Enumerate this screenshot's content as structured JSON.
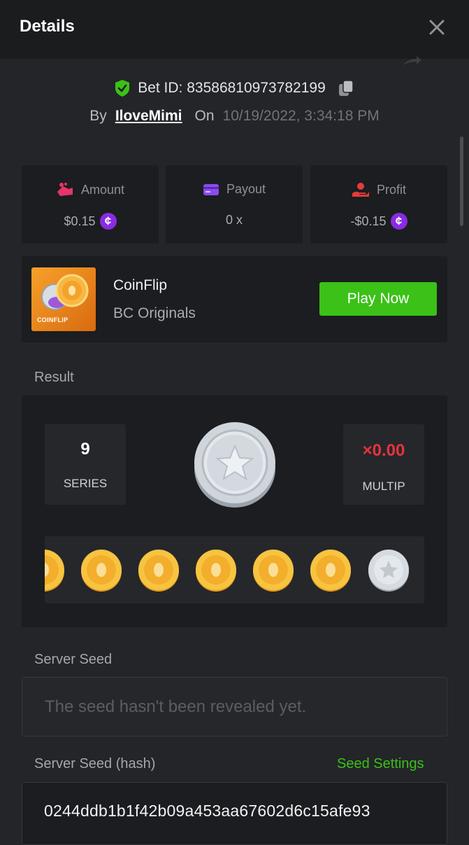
{
  "header": {
    "title": "Details"
  },
  "bet": {
    "id_label": "Bet ID: 83586810973782199",
    "by_label": "By",
    "user": "IloveMimi",
    "on_label": "On",
    "date": "10/19/2022, 3:34:18 PM"
  },
  "stats": [
    {
      "label": "Amount",
      "value": "$0.15",
      "icon": "amount-icon",
      "currency_icon": true
    },
    {
      "label": "Payout",
      "value": "0 x",
      "icon": "payout-icon",
      "currency_icon": false
    },
    {
      "label": "Profit",
      "value": "-$0.15",
      "icon": "profit-icon",
      "currency_icon": true
    }
  ],
  "game": {
    "thumb_label": "COINFLIP",
    "name": "CoinFlip",
    "provider": "BC Originals",
    "play_label": "Play Now"
  },
  "result": {
    "section_label": "Result",
    "series_value": "9",
    "series_label": "SERIES",
    "multip_value": "×0.00",
    "multip_label": "MULTIP",
    "main_coin": "silver-star",
    "strip": [
      "gold",
      "gold",
      "gold",
      "gold",
      "gold",
      "gold",
      "silver"
    ]
  },
  "server_seed": {
    "label": "Server Seed",
    "placeholder": "The seed hasn't been revealed yet."
  },
  "server_seed_hash": {
    "label": "Server Seed (hash)",
    "settings_label": "Seed Settings",
    "value": "0244ddb1b1f42b09a453aa67602d6c15afe93"
  },
  "colors": {
    "accent_green": "#3bc117",
    "currency_purple": "#8a2be2",
    "loss_red": "#e8323c",
    "background": "#232528"
  }
}
